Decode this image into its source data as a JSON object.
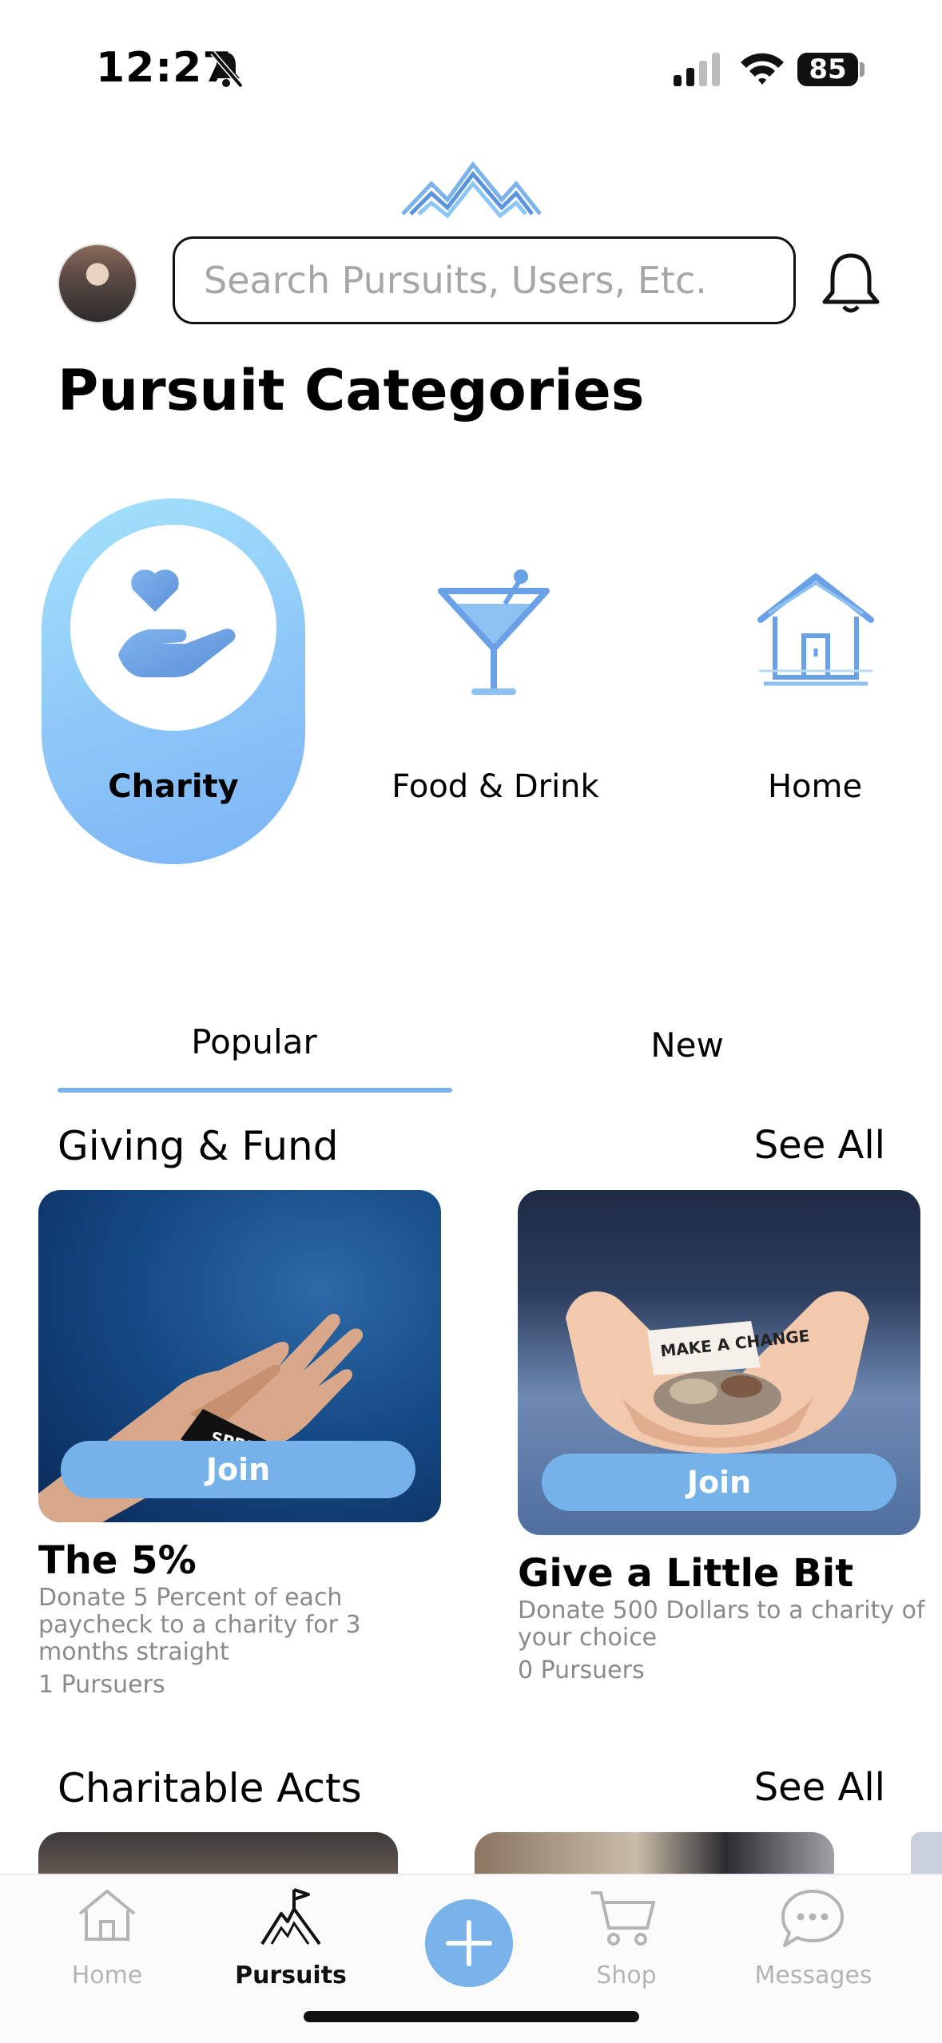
{
  "status_bar": {
    "time": "12:27",
    "battery": "85"
  },
  "search": {
    "placeholder": "Search Pursuits, Users, Etc."
  },
  "page_title": "Pursuit Categories",
  "categories": [
    {
      "label": "Charity",
      "icon": "hand-heart-icon",
      "active": true
    },
    {
      "label": "Food & Drink",
      "icon": "cocktail-icon",
      "active": false
    },
    {
      "label": "Home",
      "icon": "house-icon",
      "active": false
    }
  ],
  "tabs": [
    {
      "label": "Popular",
      "active": true
    },
    {
      "label": "New",
      "active": false
    }
  ],
  "sections": [
    {
      "title": "Giving & Fund",
      "see_all": "See All",
      "cards": [
        {
          "title": "The 5%",
          "description": "Donate 5 Percent of each paycheck to a charity for 3 months straight",
          "pursuers": "1 Pursuers",
          "join": "Join",
          "image_text": "SPREAD LOVE"
        },
        {
          "title": "Give a Little Bit",
          "description": "Donate 500 Dollars to a charity of your choice",
          "pursuers": "0 Pursuers",
          "join": "Join",
          "image_text": "MAKE A CHANGE"
        }
      ]
    },
    {
      "title": "Charitable Acts",
      "see_all": "See All"
    }
  ],
  "bottom_nav": [
    {
      "label": "Home",
      "icon": "home-icon",
      "active": false
    },
    {
      "label": "Pursuits",
      "icon": "mountain-flag-icon",
      "active": true
    },
    {
      "label": "",
      "icon": "plus-icon",
      "active": false
    },
    {
      "label": "Shop",
      "icon": "cart-icon",
      "active": false
    },
    {
      "label": "Messages",
      "icon": "chat-icon",
      "active": false
    }
  ],
  "colors": {
    "accent": "#76b2ea",
    "accent_light": "#a4e2fb",
    "text": "#000000",
    "muted": "#8a8a8a"
  }
}
